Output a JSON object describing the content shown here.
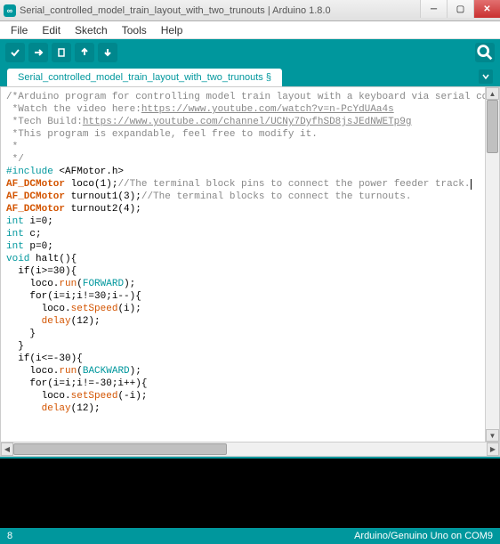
{
  "window": {
    "title": "Serial_controlled_model_train_layout_with_two_trunouts | Arduino 1.8.0",
    "app_icon_text": "∞"
  },
  "menu": {
    "file": "File",
    "edit": "Edit",
    "sketch": "Sketch",
    "tools": "Tools",
    "help": "Help"
  },
  "tabs": {
    "main": "Serial_controlled_model_train_layout_with_two_trunouts §"
  },
  "code": {
    "l01a": "/*Arduino program for controlling model train layout with a keyboard via serial communicatic",
    "l02a": " *Watch the video here:",
    "l02b": "https://www.youtube.com/watch?v=n-PcYdUAa4s",
    "l03a": " *Tech Build:",
    "l03b": "https://www.youtube.com/channel/UCNy7DyfhSD8jsJEdNWETp9g",
    "l04": " *This program is expandable, feel free to modify it.",
    "l05": " *",
    "l06": " */",
    "l07a": "#include",
    "l07b": " <AFMotor.h>",
    "l08a": "AF_DCMotor",
    "l08b": " loco(1);",
    "l08c": "//The terminal block pins to connect the power feeder track.",
    "l09a": "AF_DCMotor",
    "l09b": " turnout1(3);",
    "l09c": "//The terminal blocks to connect the turnouts.",
    "l10a": "AF_DCMotor",
    "l10b": " turnout2(4);",
    "l11a": "int",
    "l11b": " i=0;",
    "l12a": "int",
    "l12b": " c;",
    "l13a": "int",
    "l13b": " p=0;",
    "l14a": "void",
    "l14b": " halt(){",
    "l15": "  if(i>=30){",
    "l16a": "    loco.",
    "l16b": "run",
    "l16c": "(",
    "l16d": "FORWARD",
    "l16e": ");",
    "l17a": "    for(i=i;i!=30;i--){",
    "l18a": "      loco.",
    "l18b": "setSpeed",
    "l18c": "(i);",
    "l19a": "      ",
    "l19b": "delay",
    "l19c": "(12);",
    "l20": "    }",
    "l21": "  }",
    "l22": "  if(i<=-30){",
    "l23a": "    loco.",
    "l23b": "run",
    "l23c": "(",
    "l23d": "BACKWARD",
    "l23e": ");",
    "l24a": "    for(i=i;i!=-30;i++){",
    "l25a": "      loco.",
    "l25b": "setSpeed",
    "l25c": "(-i);",
    "l26a": "      ",
    "l26b": "delay",
    "l26c": "(12);"
  },
  "status": {
    "line": "8",
    "board": "Arduino/Genuino Uno on COM9"
  }
}
